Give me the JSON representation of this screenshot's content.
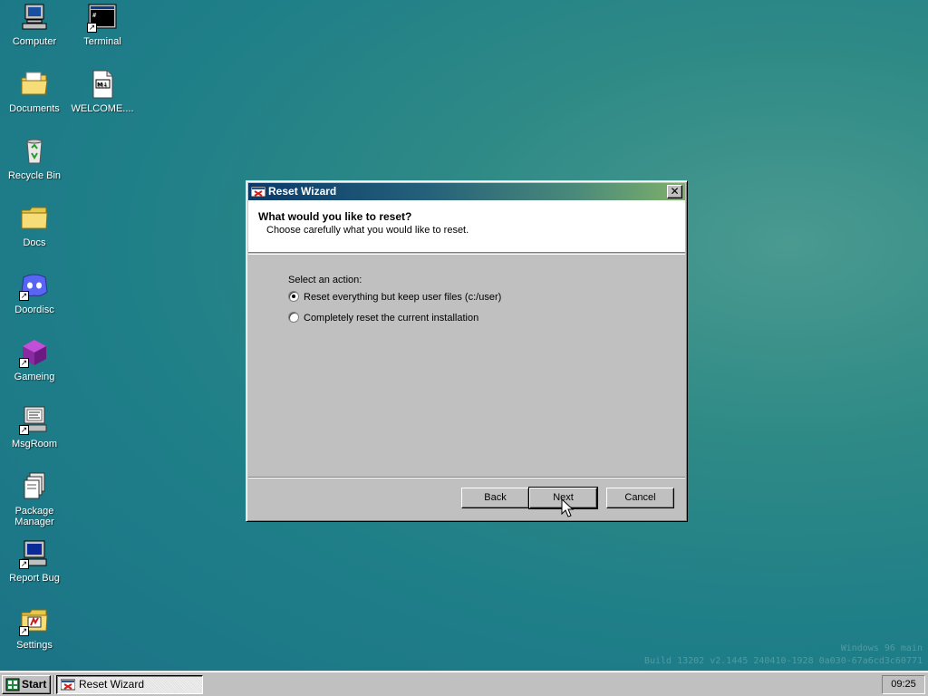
{
  "desktop": {
    "icons": [
      {
        "label": "Computer",
        "icon": "computer-icon"
      },
      {
        "label": "Terminal",
        "icon": "terminal-icon"
      },
      {
        "label": "Documents",
        "icon": "documents-folder-icon"
      },
      {
        "label": "WELCOME....",
        "icon": "markdown-file-icon"
      },
      {
        "label": "Recycle Bin",
        "icon": "recycle-bin-icon"
      },
      {
        "label": "Docs",
        "icon": "folder-icon"
      },
      {
        "label": "Doordisc",
        "icon": "doordisc-icon"
      },
      {
        "label": "Gameing",
        "icon": "gaming-cube-icon"
      },
      {
        "label": "MsgRoom",
        "icon": "msgroom-icon"
      },
      {
        "label": "Package Manager",
        "icon": "package-manager-icon"
      },
      {
        "label": "Report Bug",
        "icon": "report-bug-icon"
      },
      {
        "label": "Settings",
        "icon": "settings-icon"
      }
    ],
    "watermark_line1": "Windows 96 main",
    "watermark_line2": "Build 13202 v2.1445 240410-1928 0a030-67a6cd3c60771"
  },
  "dialog": {
    "title": "Reset Wizard",
    "close_glyph": "✕",
    "heading": "What would you like to reset?",
    "subheading": "Choose carefully what you would like to reset.",
    "action_label": "Select an action:",
    "options": [
      {
        "label": "Reset everything but keep user files (c:/user)",
        "selected": true
      },
      {
        "label": "Completely reset the current installation",
        "selected": false
      }
    ],
    "buttons": {
      "back": "Back",
      "next": "Next",
      "cancel": "Cancel"
    }
  },
  "taskbar": {
    "start_label": "Start",
    "task_label": "Reset Wizard",
    "clock": "09:25"
  },
  "colors": {
    "desktop": "#1f7f88",
    "titlebar_start": "#0a3a6a",
    "titlebar_end": "#7fb06a",
    "window_face": "#c0c0c0"
  }
}
